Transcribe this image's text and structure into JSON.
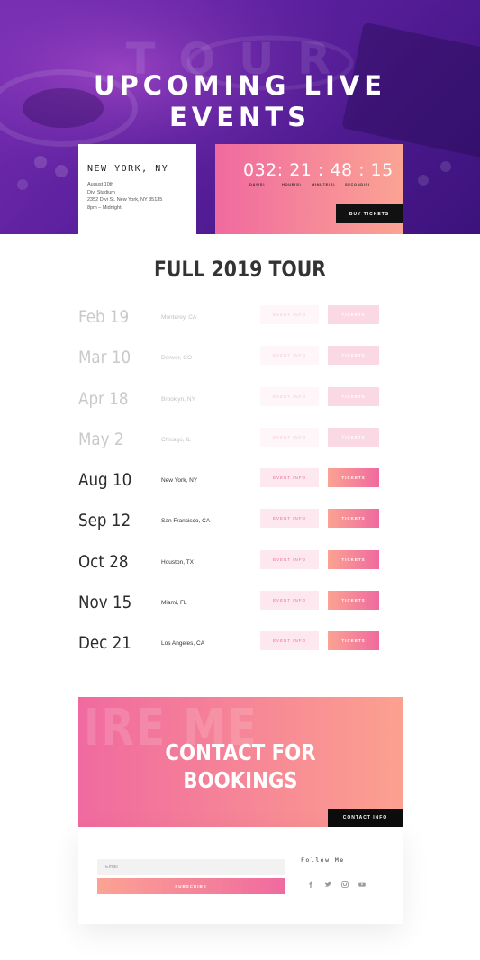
{
  "hero": {
    "bg_word": "TOUR",
    "title_line1": "UPCOMING LIVE",
    "title_line2": "EVENTS"
  },
  "next_event": {
    "city": "NEW YORK, NY",
    "date": "August 10th",
    "venue": "Divi Stadium",
    "address": "2352 Divi St. New York, NY 35135",
    "time": "8pm – Midnight"
  },
  "countdown": {
    "time": "032: 21 : 48 : 15",
    "labels": [
      "DAY(S)",
      "HOUR(S)",
      "MINUTE(S)",
      "SECOND(S)"
    ],
    "button": "BUY TICKETS"
  },
  "tour": {
    "title": "FULL 2019 TOUR",
    "info_label": "EVENT INFO",
    "tickets_label": "TICKETS",
    "events": [
      {
        "date": "Feb 19",
        "city": "Monterey, CA",
        "status": "past"
      },
      {
        "date": "Mar 10",
        "city": "Denver, CO",
        "status": "past"
      },
      {
        "date": "Apr 18",
        "city": "Brooklyn, NY",
        "status": "past"
      },
      {
        "date": "May 2",
        "city": "Chicago, IL",
        "status": "past"
      },
      {
        "date": "Aug 10",
        "city": "New York, NY",
        "status": "upcoming"
      },
      {
        "date": "Sep 12",
        "city": "San Francisco, CA",
        "status": "upcoming"
      },
      {
        "date": "Oct 28",
        "city": "Houston, TX",
        "status": "upcoming"
      },
      {
        "date": "Nov 15",
        "city": "Miami, FL",
        "status": "upcoming"
      },
      {
        "date": "Dec 21",
        "city": "Los Angeles, CA",
        "status": "upcoming"
      }
    ]
  },
  "contact": {
    "bg_word": "IRE ME",
    "title_line1": "CONTACT FOR",
    "title_line2": "BOOKINGS",
    "button": "CONTACT INFO"
  },
  "signup": {
    "email_placeholder": "Email",
    "subscribe_label": "SUBSCRIBE",
    "follow_title": "Follow Me",
    "socials": [
      "facebook-icon",
      "twitter-icon",
      "instagram-icon",
      "youtube-icon"
    ]
  },
  "colors": {
    "hero_purple": "#5a1f9c",
    "accent_pink": "#f06a9f",
    "accent_peach": "#fba393",
    "black": "#111111"
  }
}
